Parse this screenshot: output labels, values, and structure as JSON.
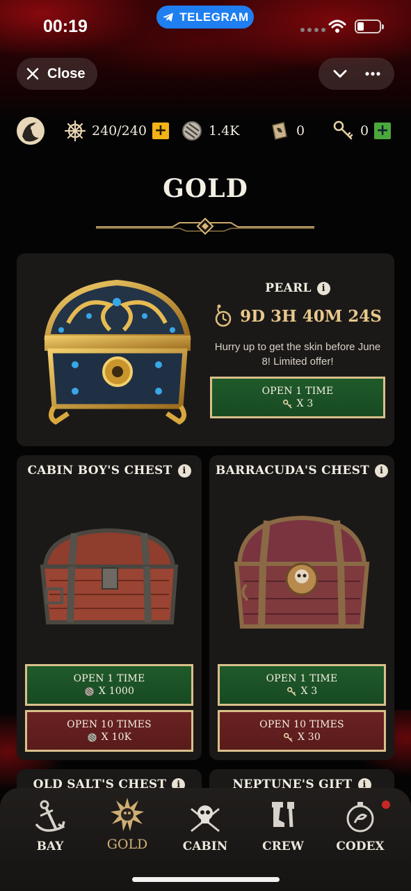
{
  "status_bar": {
    "time": "00:19",
    "telegram_label": "TELEGRAM"
  },
  "topbar": {
    "close_label": "Close"
  },
  "resources": {
    "energy": "240/240",
    "coins": "1.4K",
    "tickets": "0",
    "keys": "0"
  },
  "page": {
    "title": "GOLD"
  },
  "pearl": {
    "title": "PEARL",
    "timer": "9D 3H 40M 24S",
    "promo": "Hurry up to get the skin before June 8! Limited offer!",
    "open1_label": "OPEN 1 TIME",
    "open1_cost": "X 3"
  },
  "chests": [
    {
      "title": "CABIN BOY'S CHEST",
      "open1_label": "OPEN 1 TIME",
      "open1_cost": "X 1000",
      "open10_label": "OPEN 10 TIMES",
      "open10_cost": "X 10K"
    },
    {
      "title": "BARRACUDA'S CHEST",
      "open1_label": "OPEN 1 TIME",
      "open1_cost": "X 3",
      "open10_label": "OPEN 10 TIMES",
      "open10_cost": "X 30"
    },
    {
      "title": "OLD SALT'S CHEST"
    },
    {
      "title": "NEPTUNE'S GIFT"
    }
  ],
  "nav": [
    {
      "label": "BAY",
      "icon": "anchor-icon"
    },
    {
      "label": "GOLD",
      "icon": "gold-burst-icon"
    },
    {
      "label": "CABIN",
      "icon": "skull-crossed-swords-icon"
    },
    {
      "label": "CREW",
      "icon": "peg-leg-icon"
    },
    {
      "label": "CODEX",
      "icon": "compass-icon"
    }
  ],
  "colors": {
    "accent_gold": "#d9c08a",
    "button_green": "#1f5a2a",
    "button_red": "#6a2222",
    "card_bg": "#1b1918"
  }
}
